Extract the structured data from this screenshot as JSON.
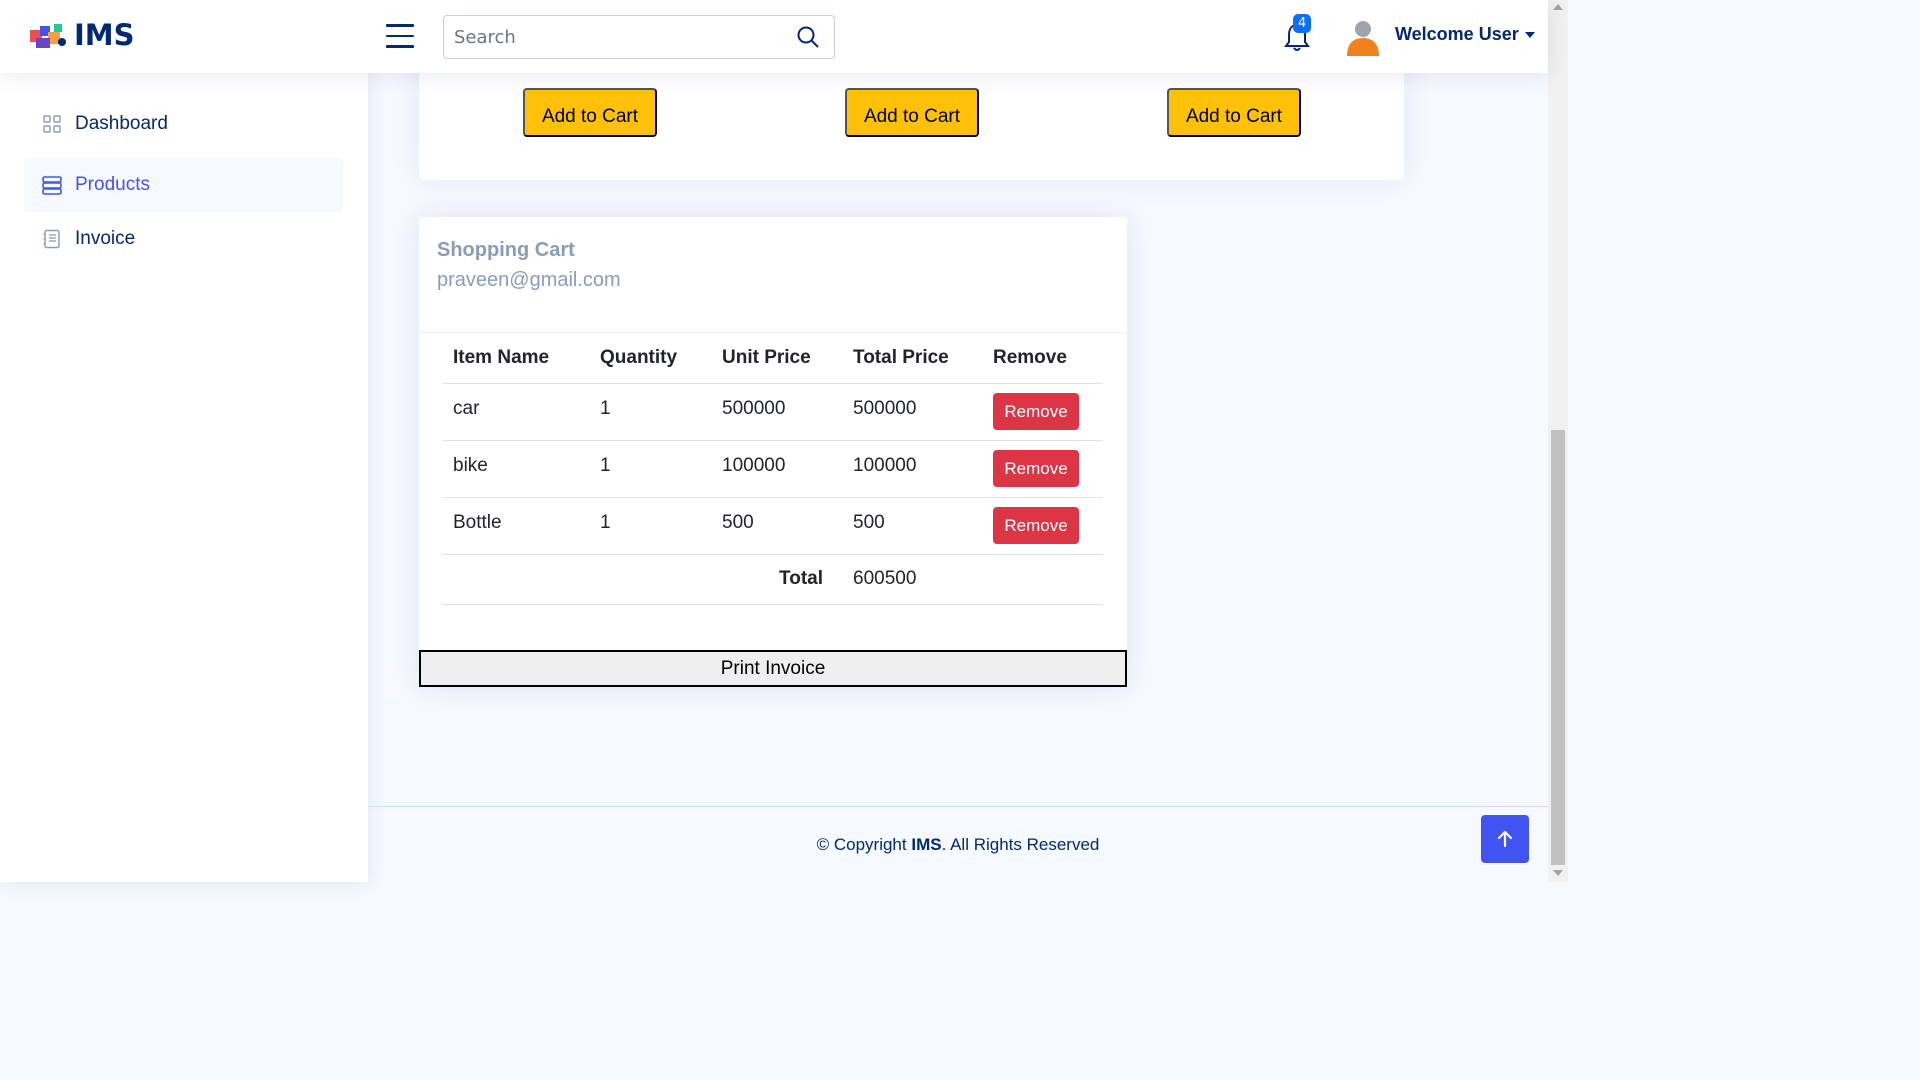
{
  "header": {
    "brand": "IMS",
    "search_placeholder": "Search",
    "notification_count": "4",
    "user_label": "Welcome User"
  },
  "sidebar": {
    "items": [
      {
        "label": "Dashboard",
        "icon": "grid-icon",
        "active": false
      },
      {
        "label": "Products",
        "icon": "layers-icon",
        "active": true
      },
      {
        "label": "Invoice",
        "icon": "journal-text-icon",
        "active": false
      }
    ]
  },
  "products": {
    "add_to_cart_label": "Add to Cart"
  },
  "cart": {
    "title": "Shopping Cart",
    "email": "praveen@gmail.com",
    "columns": [
      "Item Name",
      "Quantity",
      "Unit Price",
      "Total Price",
      "Remove"
    ],
    "rows": [
      {
        "name": "car",
        "quantity": "1",
        "unit_price": "500000",
        "total_price": "500000",
        "action": "Remove"
      },
      {
        "name": "bike",
        "quantity": "1",
        "unit_price": "100000",
        "total_price": "100000",
        "action": "Remove"
      },
      {
        "name": "Bottle",
        "quantity": "1",
        "unit_price": "500",
        "total_price": "500",
        "action": "Remove"
      }
    ],
    "total_label": "Total",
    "total_value": "600500",
    "print_label": "Print Invoice"
  },
  "footer": {
    "prefix": "© Copyright ",
    "brand": "IMS",
    "suffix": ". All Rights Reserved"
  },
  "colors": {
    "primary": "#4154f1",
    "navy": "#012970",
    "warning": "#ffc107",
    "danger": "#dc3545",
    "muted": "#899bbd"
  }
}
